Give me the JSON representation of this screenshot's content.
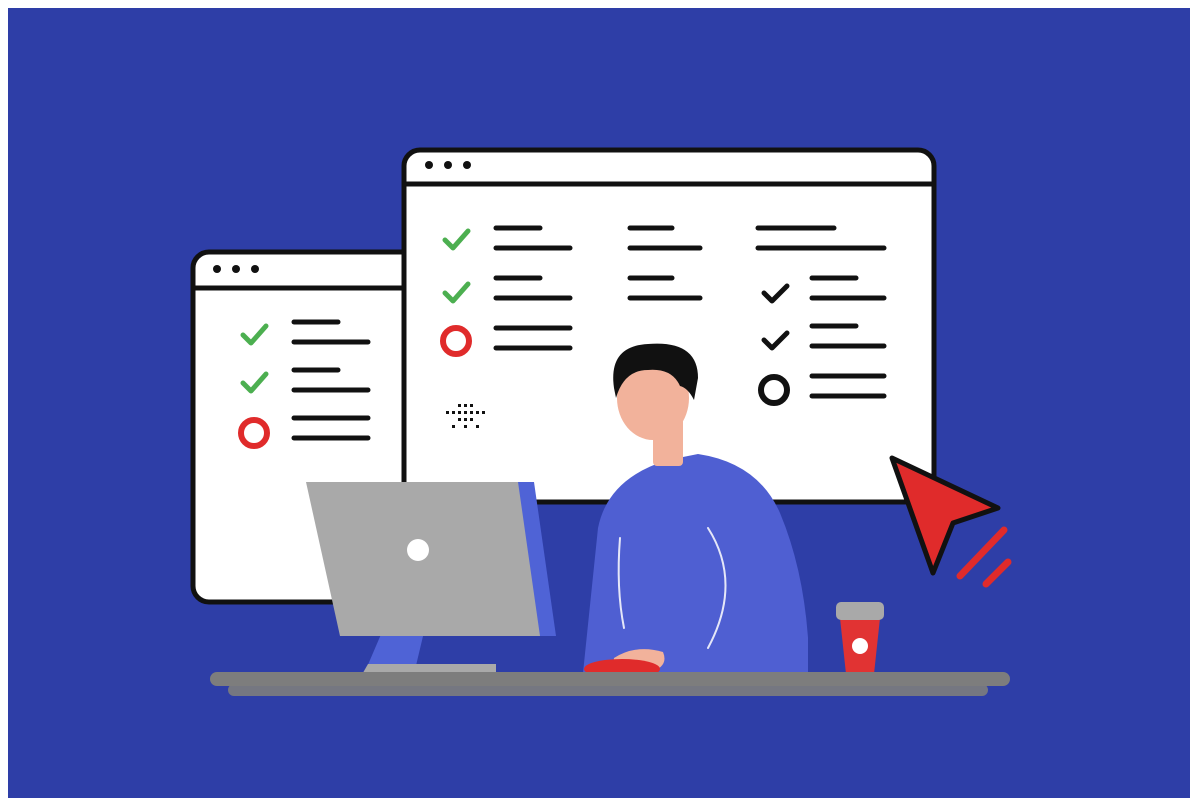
{
  "colors": {
    "background": "#2e3ea7",
    "window_fill": "#ffffff",
    "outline": "#111111",
    "check_done": "#4caf50",
    "mark_pending": "#e02b2b",
    "mark_dark": "#111111",
    "monitor": "#a9a9a9",
    "monitor_stand": "#4f63d6",
    "person_shirt": "#4f5fd2",
    "skin": "#f2b29b",
    "hair": "#111111",
    "desk": "#7d7d7d",
    "cup": "#e13333",
    "cup_lid": "#a9a9a9",
    "cursor": "#e02b2b",
    "mouse": "#e02b2b"
  },
  "icons": {
    "back_window": "browser-window-icon",
    "front_window": "browser-window-icon",
    "check_done": "checkmark-icon",
    "mark_pending": "ring-icon",
    "cursor": "cursor-arrow-icon",
    "monitor": "desktop-monitor-icon",
    "cup": "coffee-cup-icon",
    "mouse": "computer-mouse-icon"
  },
  "back_window": {
    "checklist": [
      {
        "status": "done"
      },
      {
        "status": "done"
      },
      {
        "status": "pending"
      }
    ]
  },
  "front_window": {
    "checklist_left": [
      {
        "status": "done"
      },
      {
        "status": "done"
      },
      {
        "status": "pending"
      }
    ],
    "checklist_right": [
      {
        "status": "dark-check"
      },
      {
        "status": "dark-check"
      },
      {
        "status": "dark-ring"
      }
    ]
  }
}
